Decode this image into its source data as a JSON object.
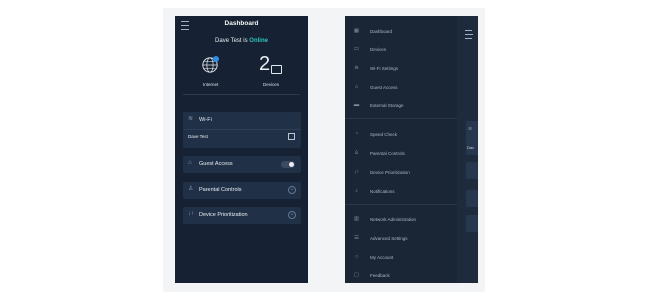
{
  "left": {
    "title": "Dashboard",
    "status_prefix": "Dave Test is",
    "status_value": "Online",
    "internet_label": "Internet",
    "devices_count": "2",
    "devices_label": "Devices",
    "wifi_label": "Wi-Fi",
    "wifi_network": "Dave Test",
    "guest_access_label": "Guest Access",
    "guest_access_enabled": false,
    "parental_controls_label": "Parental Controls",
    "device_prioritization_label": "Device Prioritization",
    "colors": {
      "background": "#162233",
      "card": "#203047",
      "online": "#2fc4c0"
    }
  },
  "menu": {
    "items": [
      {
        "label": "Dashboard",
        "icon": "dashboard-icon"
      },
      {
        "label": "Devices",
        "icon": "devices-icon"
      },
      {
        "label": "Wi-Fi Settings",
        "icon": "wifi-icon"
      },
      {
        "label": "Guest Access",
        "icon": "guest-icon"
      },
      {
        "label": "External Storage",
        "icon": "storage-icon"
      },
      {
        "label": "Speed Check",
        "icon": "speedometer-icon"
      },
      {
        "label": "Parental Controls",
        "icon": "parental-icon"
      },
      {
        "label": "Device Prioritization",
        "icon": "priority-icon"
      },
      {
        "label": "Notifications",
        "icon": "bell-icon"
      },
      {
        "label": "Network Administration",
        "icon": "network-icon"
      },
      {
        "label": "Advanced Settings",
        "icon": "sliders-icon"
      },
      {
        "label": "My Account",
        "icon": "account-icon"
      },
      {
        "label": "Feedback",
        "icon": "feedback-icon"
      }
    ],
    "peek_text": "Dav"
  }
}
